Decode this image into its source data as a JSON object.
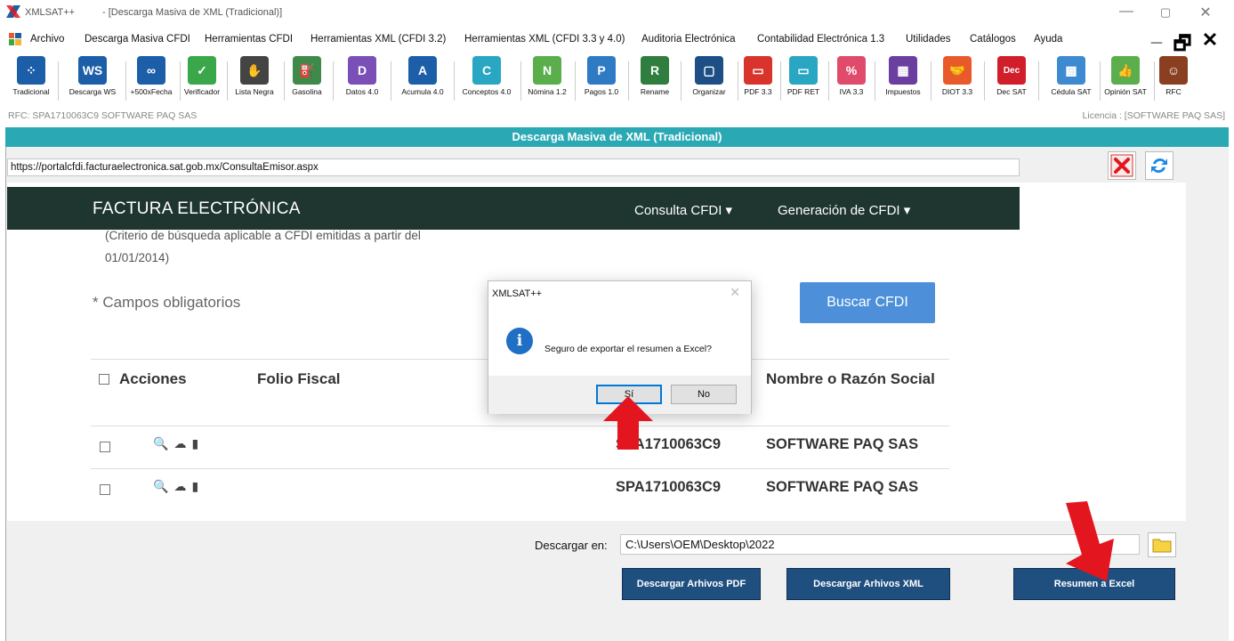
{
  "window": {
    "app_title": "XMLSAT++",
    "doc_title": "- [Descarga Masiva de XML (Tradicional)]",
    "minimize": "—",
    "restore": "▢",
    "close": "✕"
  },
  "menubar": {
    "items": [
      "Archivo",
      "Descarga Masiva CFDI",
      "Herramientas CFDI",
      "Herramientas XML (CFDI 3.2)",
      "Herramientas XML (CFDI 3.3 y 4.0)",
      "Auditoria Electrónica",
      "Contabilidad Electrónica 1.3",
      "Utilidades",
      "Catálogos",
      "Ayuda"
    ],
    "mdi_minimize": "_",
    "mdi_restore": "🗗",
    "mdi_close": "✕"
  },
  "toolbar": {
    "items": [
      {
        "label": "Tradicional",
        "icon": "grid-icon",
        "color": "#1d5ea8",
        "glyph": "⁘"
      },
      {
        "label": "Descarga WS",
        "icon": "ws-icon",
        "color": "#1d5ea8",
        "glyph": "WS"
      },
      {
        "label": "+500xFecha",
        "icon": "capsule-icon",
        "color": "#1d5ea8",
        "glyph": "∞"
      },
      {
        "label": "Verificador",
        "icon": "checkbox-icon",
        "color": "#3aa84a",
        "glyph": "✓"
      },
      {
        "label": "Lista Negra",
        "icon": "hand-stop-icon",
        "color": "#444444",
        "glyph": "✋"
      },
      {
        "label": "Gasolina",
        "icon": "fuel-pump-icon",
        "color": "#3f8a4a",
        "glyph": "⛽"
      },
      {
        "label": "Datos 4.0",
        "icon": "d-file-icon",
        "color": "#7a4fb6",
        "glyph": "D"
      },
      {
        "label": "Acumula 4.0",
        "icon": "a-file-icon",
        "color": "#1d5ea8",
        "glyph": "A"
      },
      {
        "label": "Conceptos 4.0",
        "icon": "c-file-icon",
        "color": "#29a6c1",
        "glyph": "C"
      },
      {
        "label": "Nómina 1.2",
        "icon": "n-file-icon",
        "color": "#5aaf4c",
        "glyph": "N"
      },
      {
        "label": "Pagos 1.0",
        "icon": "p-file-icon",
        "color": "#2e7bc4",
        "glyph": "P"
      },
      {
        "label": "Rename",
        "icon": "r-file-icon",
        "color": "#2f7d3f",
        "glyph": "R"
      },
      {
        "label": "Organizar",
        "icon": "organize-icon",
        "color": "#1d4f86",
        "glyph": "▢"
      },
      {
        "label": "PDF 3.3",
        "icon": "pdf-icon",
        "color": "#d9342b",
        "glyph": "▭"
      },
      {
        "label": "PDF RET",
        "icon": "pdf-ret-icon",
        "color": "#29a6c1",
        "glyph": "▭"
      },
      {
        "label": "IVA 3.3",
        "icon": "percent-icon",
        "color": "#e04a6b",
        "glyph": "%"
      },
      {
        "label": "Impuestos",
        "icon": "calculator-icon",
        "color": "#6a3fa0",
        "glyph": "▦"
      },
      {
        "label": "DIOT 3.3",
        "icon": "handshake-icon",
        "color": "#e85a2a",
        "glyph": "🤝"
      },
      {
        "label": "Dec SAT",
        "icon": "dec-icon",
        "color": "#d01f2a",
        "glyph": "Dec"
      },
      {
        "label": "Cédula SAT",
        "icon": "qr-code-icon",
        "color": "#3e8ad0",
        "glyph": "▩"
      },
      {
        "label": "Opinión SAT",
        "icon": "thumbs-up-icon",
        "color": "#5aaf4c",
        "glyph": "👍"
      },
      {
        "label": "RFC",
        "icon": "person-icon",
        "color": "#8a4020",
        "glyph": "☺"
      }
    ]
  },
  "info": {
    "rfc": "RFC: SPA1710063C9 SOFTWARE PAQ SAS",
    "license": "Licencia : [SOFTWARE PAQ SAS]"
  },
  "banner": {
    "title": "Descarga Masiva de XML (Tradicional)"
  },
  "browser": {
    "url": "https://portalcfdi.facturaelectronica.sat.gob.mx/ConsultaEmisor.aspx"
  },
  "portal": {
    "brand": "FACTURA ELECTRÓNICA",
    "nav": [
      "Consulta CFDI ▾",
      "Generación de CFDI ▾"
    ],
    "criteria_line1": "(Criterio de búsqueda aplicable a CFDI emitidas a partir del",
    "criteria_line2": "01/01/2014)",
    "required_note": "* Campos obligatorios",
    "search_button": "Buscar CFDI",
    "columns": [
      "Acciones",
      "Folio Fiscal",
      "Nombre o Razón Social"
    ],
    "rows": [
      {
        "rfc": "SPA1710063C9",
        "name": "SOFTWARE PAQ SAS"
      },
      {
        "rfc": "SPA1710063C9",
        "name": "SOFTWARE PAQ SAS"
      }
    ]
  },
  "bottom": {
    "download_label": "Descargar en:",
    "download_path": "C:\\Users\\OEM\\Desktop\\2022",
    "btn_pdf": "Descargar Arhivos PDF",
    "btn_xml": "Descargar Arhivos XML",
    "btn_excel": "Resumen a Excel"
  },
  "dialog": {
    "title": "XMLSAT++",
    "close": "✕",
    "icon_glyph": "i",
    "message": "Seguro de exportar el resumen a Excel?",
    "yes": "Sí",
    "no": "No"
  },
  "colors": {
    "banner": "#2aa9b4",
    "portal_nav": "#1e3530",
    "search_button": "#4d90d9",
    "action_button": "#1f4f7f",
    "arrow": "#e3161f"
  }
}
